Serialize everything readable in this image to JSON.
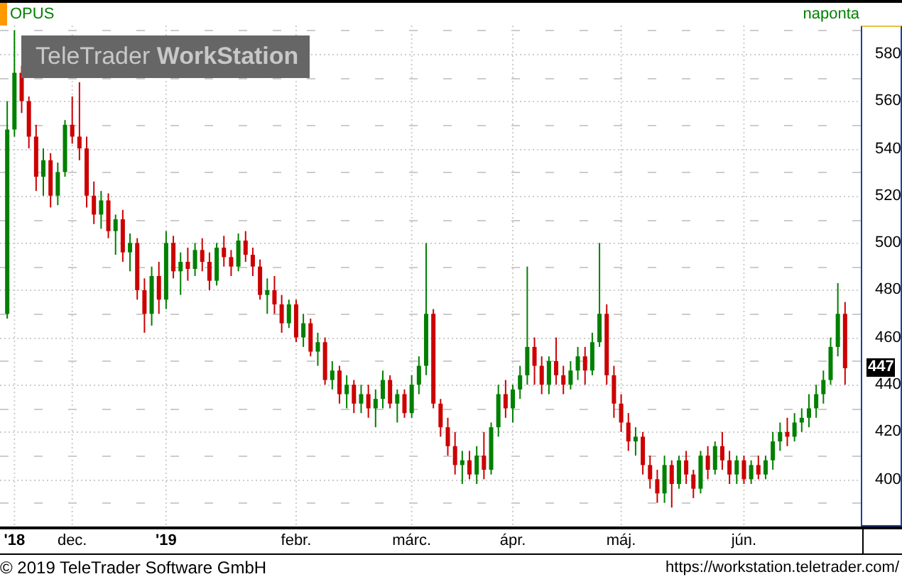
{
  "legend": {
    "instrument": "OPUS",
    "interval": "naponta"
  },
  "logo": {
    "brand": "TeleTrader",
    "product": "WorkStation"
  },
  "chart_data": {
    "type": "candlestick",
    "ylim": [
      380,
      592
    ],
    "grid": true,
    "yticks": [
      {
        "value": 580,
        "label": "580"
      },
      {
        "value": 560,
        "label": "560"
      },
      {
        "value": 540,
        "label": "540"
      },
      {
        "value": 520,
        "label": "520"
      },
      {
        "value": 500,
        "label": "500"
      },
      {
        "value": 480,
        "label": "480"
      },
      {
        "value": 460,
        "label": "460"
      },
      {
        "value": 440,
        "label": "440"
      },
      {
        "value": 420,
        "label": "420"
      },
      {
        "value": 400,
        "label": "400"
      }
    ],
    "categories": [
      null,
      null,
      null,
      null,
      null,
      null,
      null,
      null,
      null,
      null,
      null,
      null,
      null,
      null,
      null,
      null,
      null,
      null,
      null,
      null,
      null,
      null,
      null,
      null,
      null,
      null,
      null,
      null,
      null,
      null,
      null,
      null,
      null,
      null,
      null,
      null,
      null,
      null,
      null,
      null,
      null,
      null,
      null,
      null,
      null,
      null,
      null,
      null,
      null,
      null,
      null,
      null,
      null,
      null,
      null,
      null,
      null,
      null,
      null,
      null,
      null,
      null,
      null,
      null,
      null,
      null,
      null,
      null,
      null,
      null,
      null,
      null,
      null,
      null,
      null,
      null,
      null,
      null,
      null,
      null,
      null,
      null,
      null,
      null,
      null,
      null,
      null,
      null,
      null,
      null,
      null,
      null,
      null,
      null,
      null,
      null,
      null,
      null,
      null,
      null,
      null,
      null,
      null,
      null,
      null,
      null,
      null,
      null,
      null,
      null,
      null,
      null,
      null,
      null,
      null,
      null,
      null
    ],
    "ohlc": [
      [
        470,
        560,
        468,
        548
      ],
      [
        548,
        590,
        545,
        572
      ],
      [
        572,
        575,
        555,
        560
      ],
      [
        560,
        562,
        540,
        545
      ],
      [
        545,
        550,
        522,
        528
      ],
      [
        528,
        540,
        520,
        535
      ],
      [
        535,
        538,
        515,
        520
      ],
      [
        520,
        534,
        516,
        530
      ],
      [
        530,
        552,
        528,
        550
      ],
      [
        550,
        562,
        542,
        545
      ],
      [
        545,
        568,
        535,
        540
      ],
      [
        540,
        545,
        515,
        520
      ],
      [
        520,
        526,
        508,
        512
      ],
      [
        512,
        522,
        506,
        518
      ],
      [
        518,
        521,
        502,
        505
      ],
      [
        505,
        512,
        495,
        510
      ],
      [
        510,
        514,
        492,
        496
      ],
      [
        496,
        504,
        488,
        500
      ],
      [
        500,
        502,
        476,
        480
      ],
      [
        480,
        485,
        462,
        470
      ],
      [
        470,
        490,
        465,
        486
      ],
      [
        486,
        492,
        470,
        476
      ],
      [
        476,
        505,
        472,
        500
      ],
      [
        500,
        503,
        485,
        488
      ],
      [
        488,
        496,
        478,
        492
      ],
      [
        492,
        498,
        484,
        489
      ],
      [
        489,
        500,
        486,
        497
      ],
      [
        497,
        502,
        488,
        492
      ],
      [
        492,
        496,
        480,
        484
      ],
      [
        484,
        500,
        482,
        498
      ],
      [
        498,
        503,
        490,
        494
      ],
      [
        494,
        497,
        486,
        490
      ],
      [
        490,
        504,
        488,
        501
      ],
      [
        501,
        505,
        492,
        495
      ],
      [
        495,
        498,
        486,
        490
      ],
      [
        490,
        493,
        476,
        478
      ],
      [
        478,
        485,
        470,
        480
      ],
      [
        480,
        486,
        470,
        474
      ],
      [
        474,
        478,
        462,
        466
      ],
      [
        466,
        476,
        464,
        474
      ],
      [
        474,
        476,
        458,
        460
      ],
      [
        460,
        470,
        456,
        466
      ],
      [
        466,
        468,
        452,
        454
      ],
      [
        454,
        462,
        448,
        458
      ],
      [
        458,
        460,
        440,
        442
      ],
      [
        442,
        450,
        438,
        446
      ],
      [
        446,
        448,
        432,
        436
      ],
      [
        436,
        444,
        430,
        440
      ],
      [
        440,
        442,
        428,
        432
      ],
      [
        432,
        440,
        428,
        436
      ],
      [
        436,
        440,
        426,
        430
      ],
      [
        430,
        438,
        422,
        434
      ],
      [
        434,
        446,
        430,
        442
      ],
      [
        442,
        444,
        430,
        432
      ],
      [
        432,
        438,
        424,
        436
      ],
      [
        436,
        438,
        426,
        428
      ],
      [
        428,
        444,
        426,
        440
      ],
      [
        440,
        452,
        436,
        448
      ],
      [
        448,
        500,
        444,
        470
      ],
      [
        470,
        472,
        430,
        432
      ],
      [
        432,
        434,
        418,
        422
      ],
      [
        422,
        426,
        410,
        414
      ],
      [
        414,
        420,
        402,
        406
      ],
      [
        406,
        412,
        398,
        408
      ],
      [
        408,
        412,
        400,
        402
      ],
      [
        402,
        414,
        398,
        410
      ],
      [
        410,
        420,
        400,
        404
      ],
      [
        404,
        424,
        402,
        422
      ],
      [
        422,
        440,
        418,
        436
      ],
      [
        436,
        442,
        426,
        430
      ],
      [
        430,
        440,
        424,
        438
      ],
      [
        438,
        448,
        434,
        444
      ],
      [
        444,
        490,
        440,
        456
      ],
      [
        456,
        460,
        440,
        448
      ],
      [
        448,
        452,
        436,
        440
      ],
      [
        440,
        452,
        436,
        450
      ],
      [
        450,
        460,
        440,
        444
      ],
      [
        444,
        448,
        436,
        440
      ],
      [
        440,
        450,
        438,
        446
      ],
      [
        446,
        456,
        442,
        452
      ],
      [
        452,
        456,
        440,
        446
      ],
      [
        446,
        462,
        444,
        458
      ],
      [
        458,
        500,
        456,
        470
      ],
      [
        470,
        474,
        440,
        444
      ],
      [
        444,
        448,
        426,
        432
      ],
      [
        432,
        436,
        420,
        424
      ],
      [
        424,
        428,
        412,
        416
      ],
      [
        416,
        422,
        410,
        418
      ],
      [
        418,
        420,
        402,
        406
      ],
      [
        406,
        410,
        396,
        400
      ],
      [
        400,
        404,
        390,
        394
      ],
      [
        394,
        410,
        390,
        406
      ],
      [
        406,
        408,
        388,
        398
      ],
      [
        398,
        410,
        396,
        408
      ],
      [
        408,
        412,
        398,
        402
      ],
      [
        402,
        404,
        392,
        396
      ],
      [
        396,
        412,
        394,
        410
      ],
      [
        410,
        414,
        400,
        404
      ],
      [
        404,
        416,
        402,
        414
      ],
      [
        414,
        420,
        404,
        408
      ],
      [
        408,
        412,
        398,
        402
      ],
      [
        402,
        410,
        398,
        408
      ],
      [
        408,
        410,
        398,
        400
      ],
      [
        400,
        408,
        398,
        406
      ],
      [
        406,
        410,
        400,
        402
      ],
      [
        402,
        410,
        400,
        408
      ],
      [
        408,
        420,
        404,
        416
      ],
      [
        416,
        424,
        412,
        420
      ],
      [
        420,
        426,
        414,
        418
      ],
      [
        418,
        428,
        416,
        424
      ],
      [
        424,
        430,
        420,
        426
      ],
      [
        426,
        436,
        422,
        430
      ],
      [
        430,
        440,
        426,
        436
      ],
      [
        436,
        446,
        432,
        442
      ],
      [
        442,
        460,
        440,
        456
      ],
      [
        456,
        483,
        452,
        470
      ],
      [
        470,
        475,
        440,
        447
      ]
    ]
  },
  "x_axis": {
    "labels": [
      {
        "text": "'18",
        "kind": "year"
      },
      {
        "text": "dec.",
        "kind": "month"
      },
      {
        "text": "'19",
        "kind": "year"
      },
      {
        "text": "febr.",
        "kind": "month"
      },
      {
        "text": "márc.",
        "kind": "month"
      },
      {
        "text": "ápr.",
        "kind": "month"
      },
      {
        "text": "máj.",
        "kind": "month"
      },
      {
        "text": "jún.",
        "kind": "month"
      }
    ]
  },
  "last_price": "447",
  "footer": {
    "copyright": "© 2019 TeleTrader Software GmbH",
    "url": "https://workstation.teletrader.com/"
  }
}
